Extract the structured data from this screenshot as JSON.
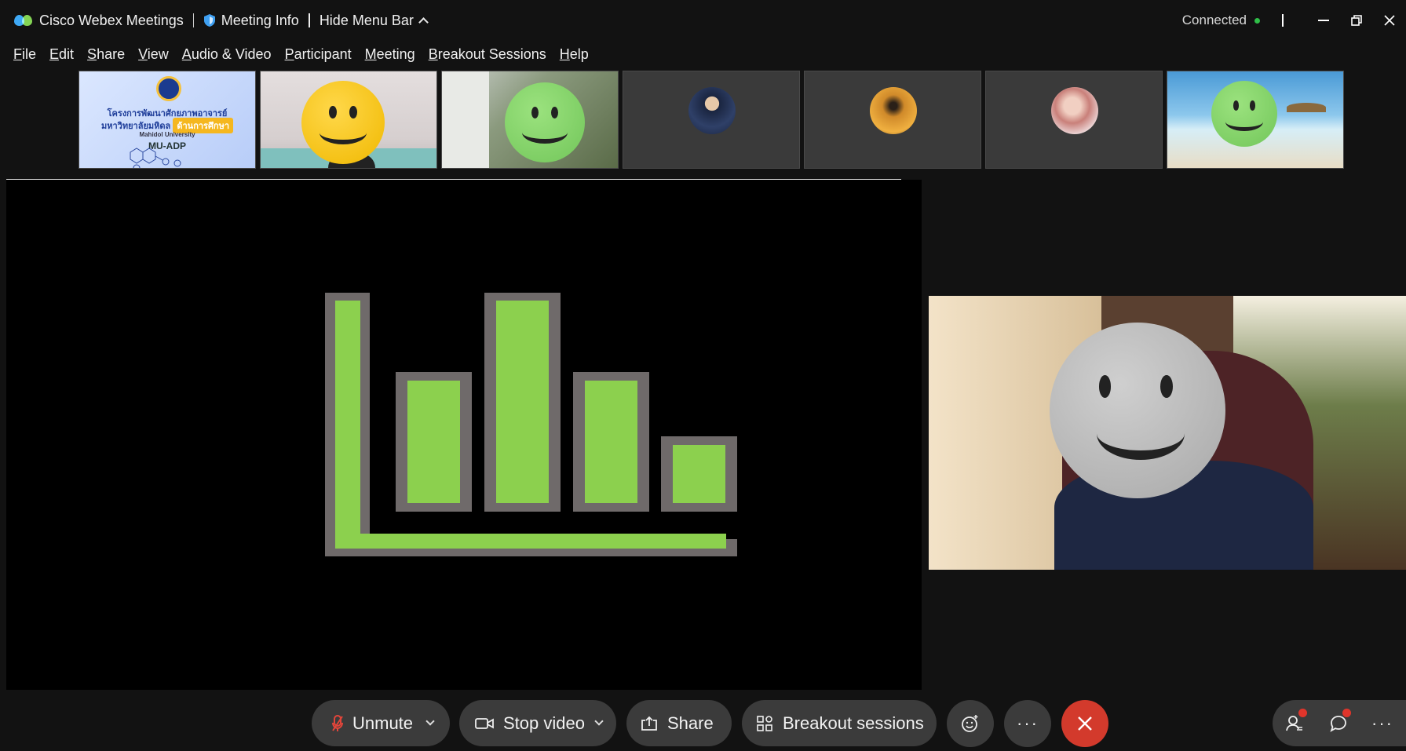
{
  "titlebar": {
    "app_name": "Cisco Webex Meetings",
    "meeting_info": "Meeting Info",
    "hide_menu": "Hide Menu Bar",
    "status": "Connected",
    "status_color": "#2fbf48"
  },
  "menu": [
    {
      "mn": "F",
      "rest": "ile"
    },
    {
      "mn": "E",
      "rest": "dit"
    },
    {
      "mn": "S",
      "rest": "hare"
    },
    {
      "mn": "V",
      "rest": "iew"
    },
    {
      "mn": "A",
      "rest": "udio & Video"
    },
    {
      "mn": "P",
      "rest": "articipant"
    },
    {
      "mn": "M",
      "rest": "eeting"
    },
    {
      "mn": "B",
      "rest": "reakout Sessions"
    },
    {
      "mn": "H",
      "rest": "elp"
    }
  ],
  "slide": {
    "line1": "โครงการพัฒนาศักยภาพอาจารย์",
    "line2": "มหาวิทยาลัยมหิดล",
    "tag": "ด้านการศึกษา",
    "line3": "Mahidol University",
    "line4": "MU-ADP"
  },
  "toolbar": {
    "unmute": "Unmute",
    "stop_video": "Stop video",
    "share": "Share",
    "breakout": "Breakout sessions",
    "end_color": "#d33a2c"
  },
  "icons": {
    "mic": "mic-muted-icon",
    "video": "video-camera-icon",
    "share": "share-screen-icon",
    "breakout": "breakout-grid-icon",
    "reactions": "emoji-icon",
    "more": "more-icon",
    "end": "close-icon",
    "participants": "participants-icon",
    "chat": "chat-icon"
  }
}
